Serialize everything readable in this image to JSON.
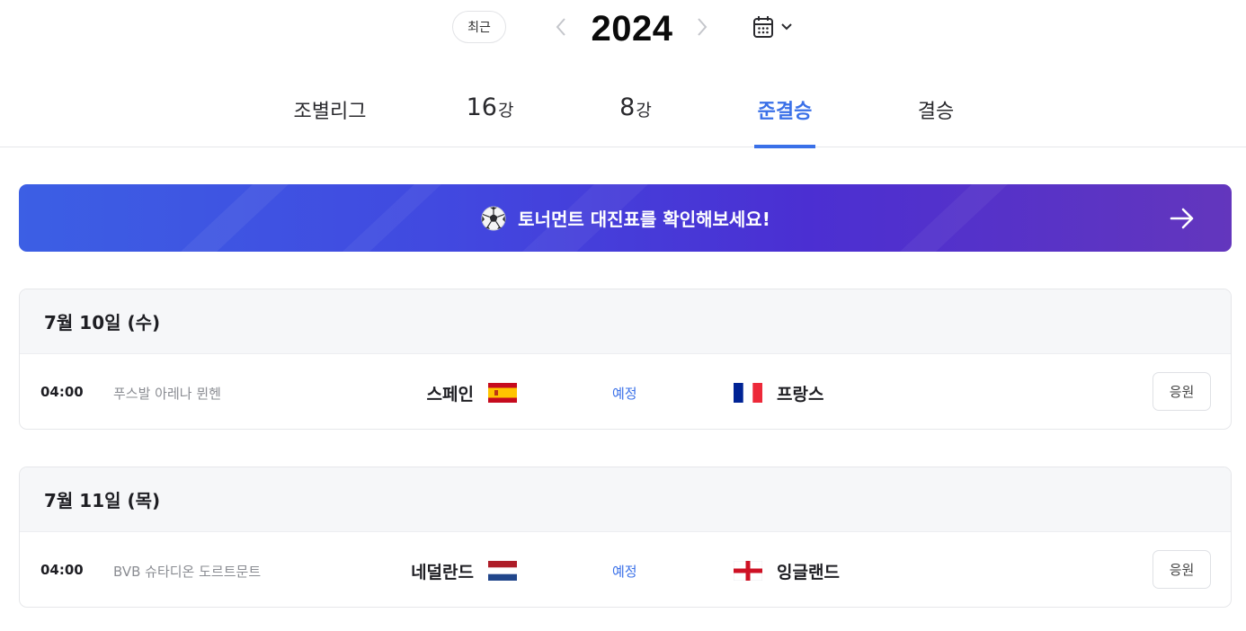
{
  "year_nav": {
    "recent_label": "최근",
    "year": "2024",
    "prev_icon": "chevron-left-icon",
    "next_icon": "chevron-right-icon",
    "calendar_icon": "calendar-icon",
    "dropdown_icon": "chevron-down-icon"
  },
  "tabs": [
    {
      "label": "조별리그",
      "active": false
    },
    {
      "num": "16",
      "suffix": "강",
      "active": false
    },
    {
      "num": "8",
      "suffix": "강",
      "active": false
    },
    {
      "label": "준결승",
      "active": true
    },
    {
      "label": "결승",
      "active": false
    }
  ],
  "banner": {
    "text": "토너먼트 대진표를 확인해보세요!",
    "icon": "soccer-ball-icon",
    "arrow_icon": "arrow-right-icon",
    "colors": [
      "#3c5fe4",
      "#4b2fd2",
      "#6336bd"
    ]
  },
  "days": [
    {
      "date": "7월 10일 (수)",
      "matches": [
        {
          "time": "04:00",
          "venue": "푸스발 아레나 뮌헨",
          "home": "스페인",
          "home_flag": "spain-flag-icon",
          "status": "예정",
          "away": "프랑스",
          "away_flag": "france-flag-icon",
          "cheer": "응원"
        }
      ]
    },
    {
      "date": "7월 11일 (목)",
      "matches": [
        {
          "time": "04:00",
          "venue": "BVB 슈타디온 도르트문트",
          "home": "네덜란드",
          "home_flag": "netherlands-flag-icon",
          "status": "예정",
          "away": "잉글랜드",
          "away_flag": "england-flag-icon",
          "cheer": "응원"
        }
      ]
    }
  ],
  "accent_color": "#3a70e8"
}
